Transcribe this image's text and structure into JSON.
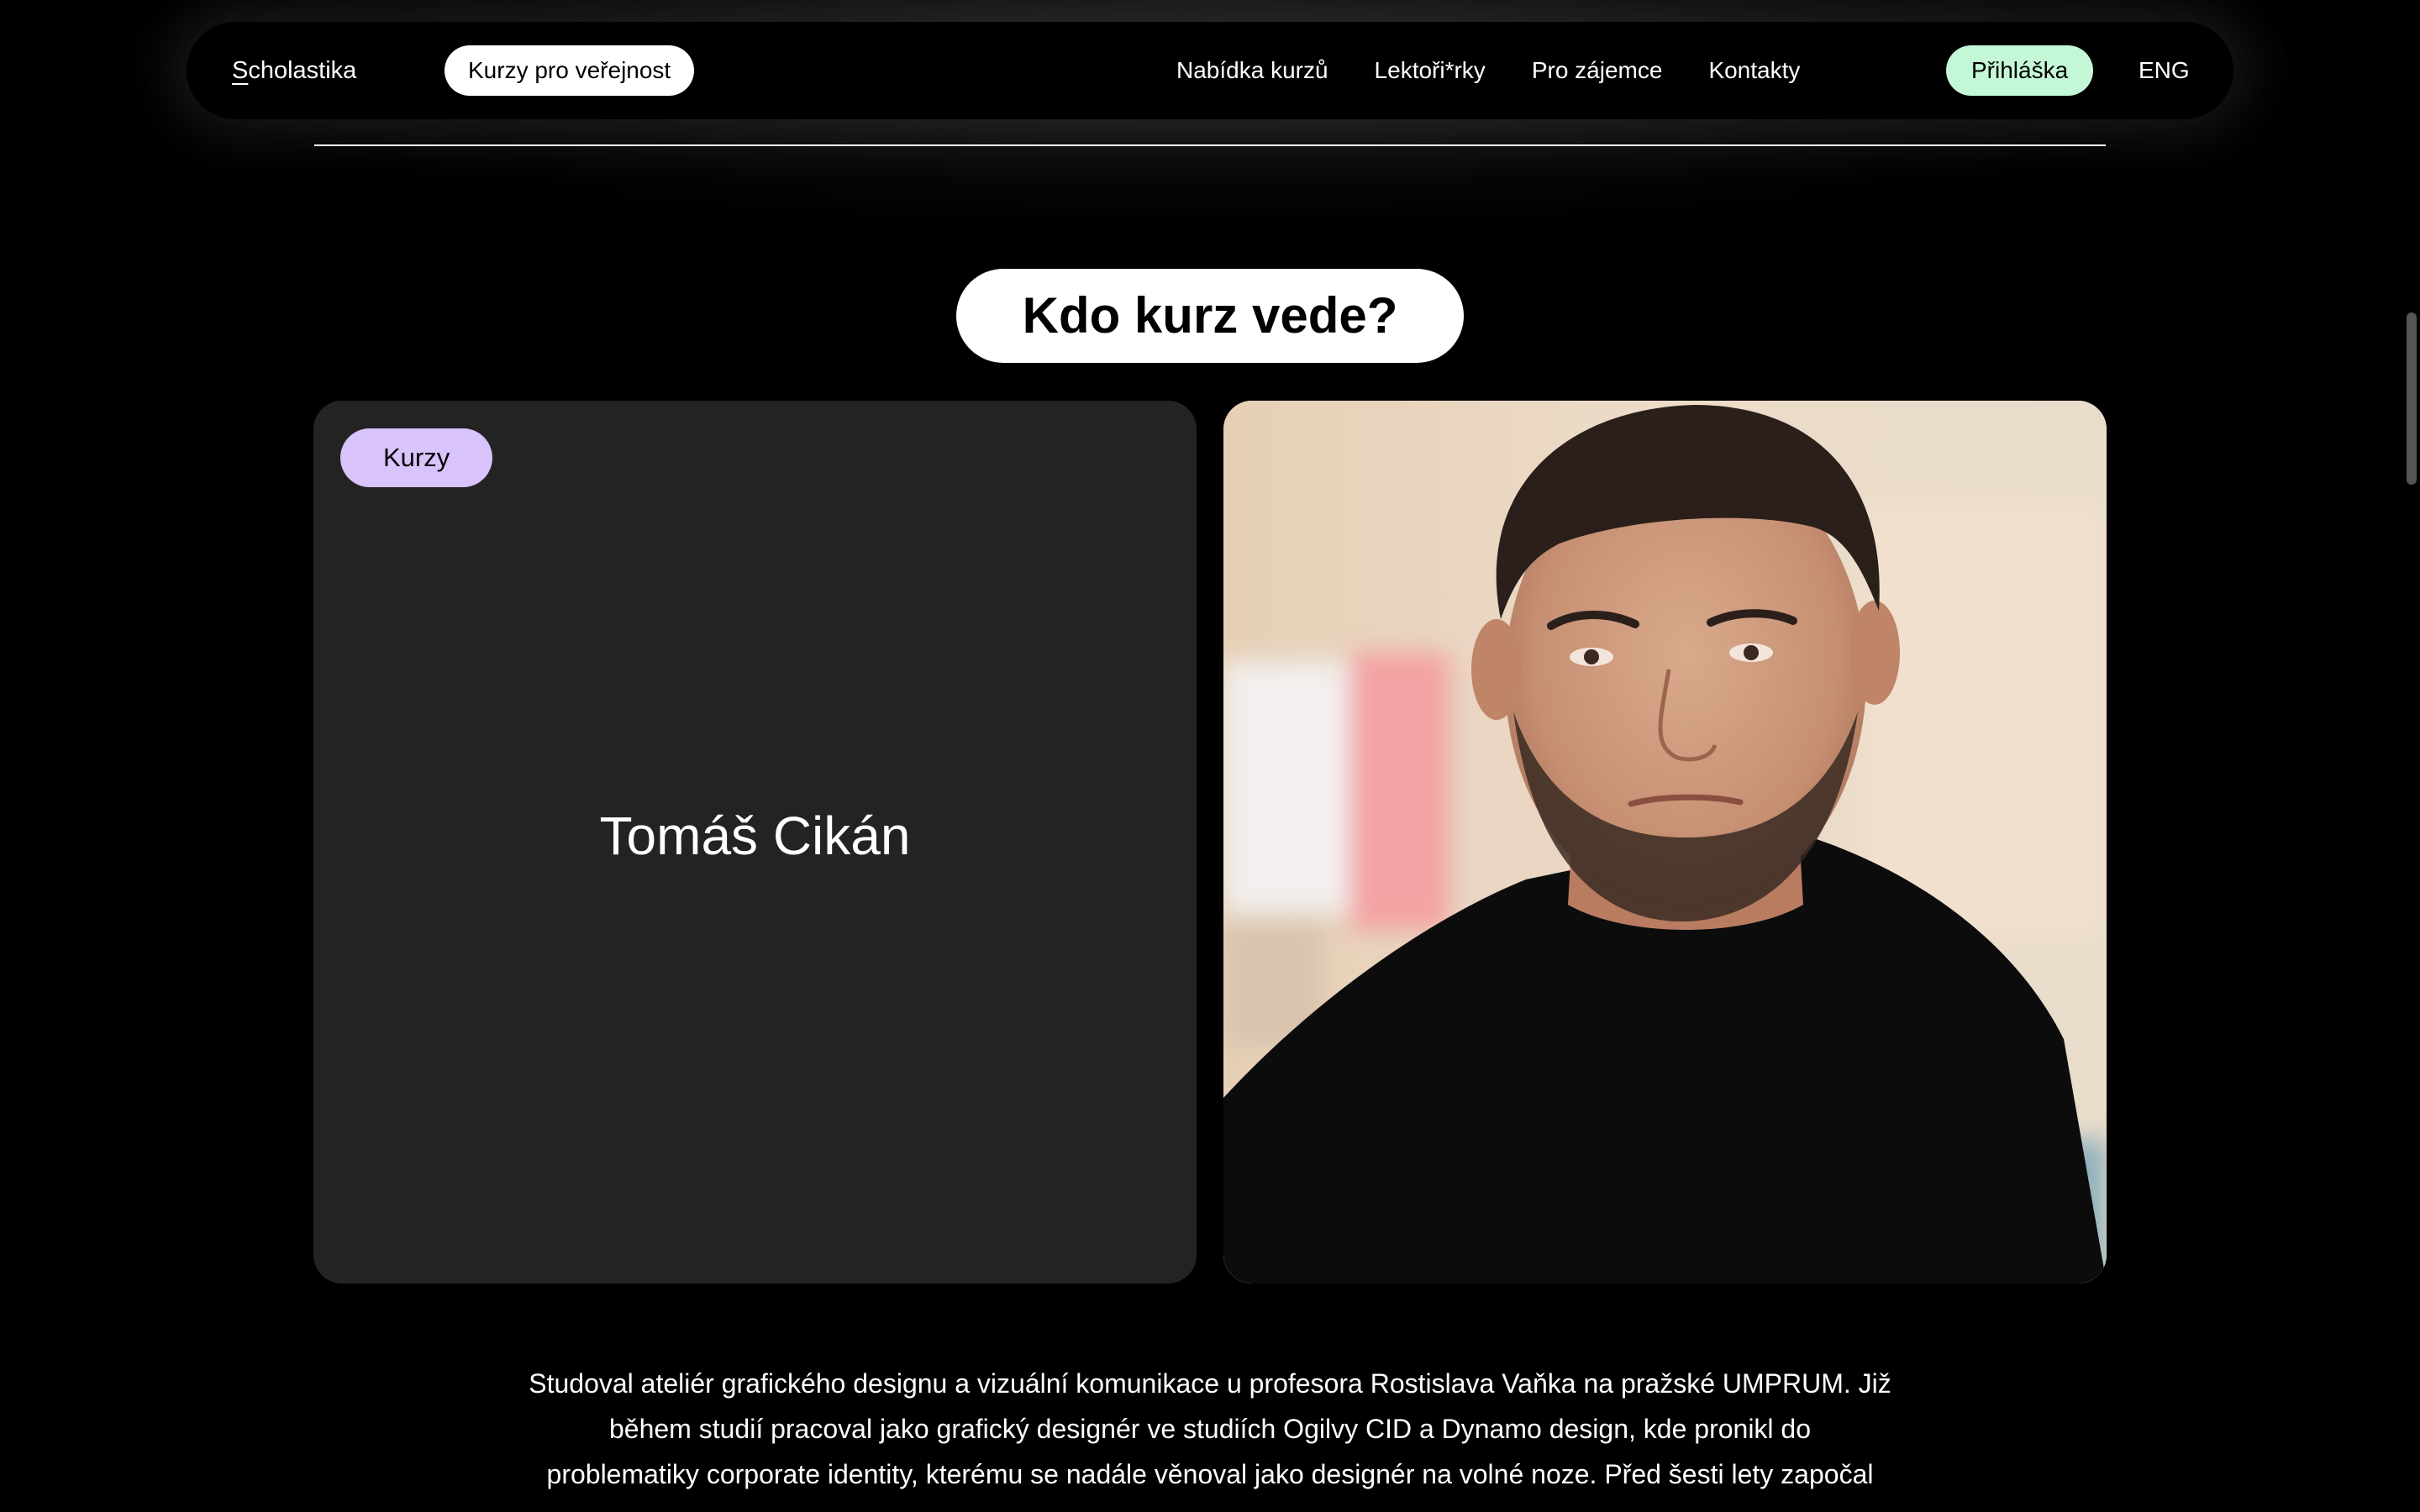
{
  "nav": {
    "logo_first": "S",
    "logo_rest": "cholastika",
    "public_courses": "Kurzy pro veřejnost",
    "links": [
      "Nabídka kurzů",
      "Lektoři*rky",
      "Pro zájemce",
      "Kontakty"
    ],
    "apply": "Přihláška",
    "lang": "ENG"
  },
  "section": {
    "title": "Kdo kurz vede?"
  },
  "lecturer": {
    "tag": "Kurzy",
    "name": "Tomáš Cikán",
    "photo_icon": "portrait-photo"
  },
  "bio": {
    "line1": "Studoval ateliér grafického designu a vizuální komunikace u profesora Rostislava Vaňka na pražské UMPRUM. Již",
    "line2": "během studií pracoval jako grafický designér ve studiích Ogilvy CID a Dynamo design, kde pronikl do",
    "line3": "problematiky corporate identity, kterému se nadále věnoval jako designér na volné noze. Před šesti lety započal"
  },
  "colors": {
    "background": "#000000",
    "card": "#232323",
    "tag": "#d8c3fb",
    "apply": "#c4f7d6",
    "pill": "#ffffff"
  }
}
